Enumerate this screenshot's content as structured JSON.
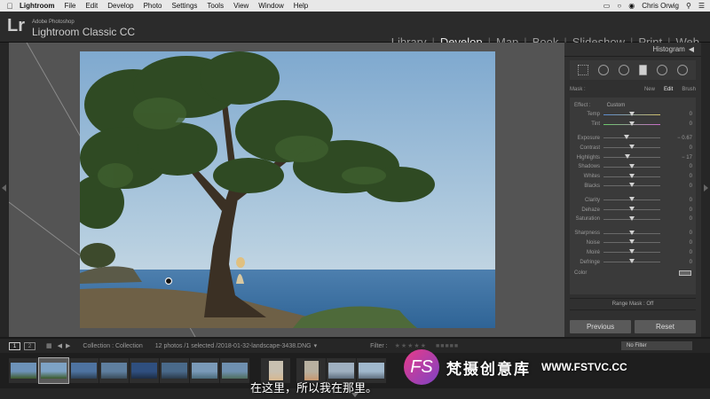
{
  "menubar": {
    "app": "Lightroom",
    "items": [
      "File",
      "Edit",
      "Develop",
      "Photo",
      "Settings",
      "Tools",
      "View",
      "Window",
      "Help"
    ],
    "user": "Chris Orwig"
  },
  "title": {
    "logo": "Lr",
    "vendor": "Adobe Photoshop",
    "product": "Lightroom Classic CC"
  },
  "modules": [
    "Library",
    "Develop",
    "Map",
    "Book",
    "Slideshow",
    "Print",
    "Web"
  ],
  "active_module": "Develop",
  "panel": {
    "histogram_label": "Histogram",
    "mask": {
      "label": "Mask :",
      "new": "New",
      "edit": "Edit",
      "brush": "Brush"
    },
    "effect": {
      "label": "Effect :",
      "value": "Custom"
    },
    "sliders": [
      {
        "label": "Temp",
        "value": "0",
        "pos": 0.5
      },
      {
        "label": "Tint",
        "value": "0",
        "pos": 0.5
      },
      {
        "label": "Exposure",
        "value": "− 0.67",
        "pos": 0.4
      },
      {
        "label": "Contrast",
        "value": "0",
        "pos": 0.5
      },
      {
        "label": "Highlights",
        "value": "− 17",
        "pos": 0.42
      },
      {
        "label": "Shadows",
        "value": "0",
        "pos": 0.5
      },
      {
        "label": "Whites",
        "value": "0",
        "pos": 0.5
      },
      {
        "label": "Blacks",
        "value": "0",
        "pos": 0.5
      },
      {
        "label": "Clarity",
        "value": "0",
        "pos": 0.5
      },
      {
        "label": "Dehaze",
        "value": "0",
        "pos": 0.5
      },
      {
        "label": "Saturation",
        "value": "0",
        "pos": 0.5
      },
      {
        "label": "Sharpness",
        "value": "0",
        "pos": 0.5
      },
      {
        "label": "Noise",
        "value": "0",
        "pos": 0.5
      },
      {
        "label": "Moiré",
        "value": "0",
        "pos": 0.5
      },
      {
        "label": "Defringe",
        "value": "0",
        "pos": 0.5
      }
    ],
    "color_label": "Color",
    "range_mask": "Range Mask : Off",
    "previous": "Previous",
    "reset": "Reset"
  },
  "filmbar": {
    "page1": "1",
    "page2": "2",
    "source": "Collection : Collection",
    "count": "12 photos /1 selected /2018-01-32-landscape-3438.DNG",
    "filter_label": "Filter :",
    "no_filter": "No Filter"
  },
  "filmstrip_selected_index": 1,
  "overlay": {
    "subtitle": "在这里，所以我在那里。",
    "watermark_logo": "FS",
    "watermark_cn": "梵摄创意库",
    "watermark_url": "WWW.FSTVC.CC"
  }
}
